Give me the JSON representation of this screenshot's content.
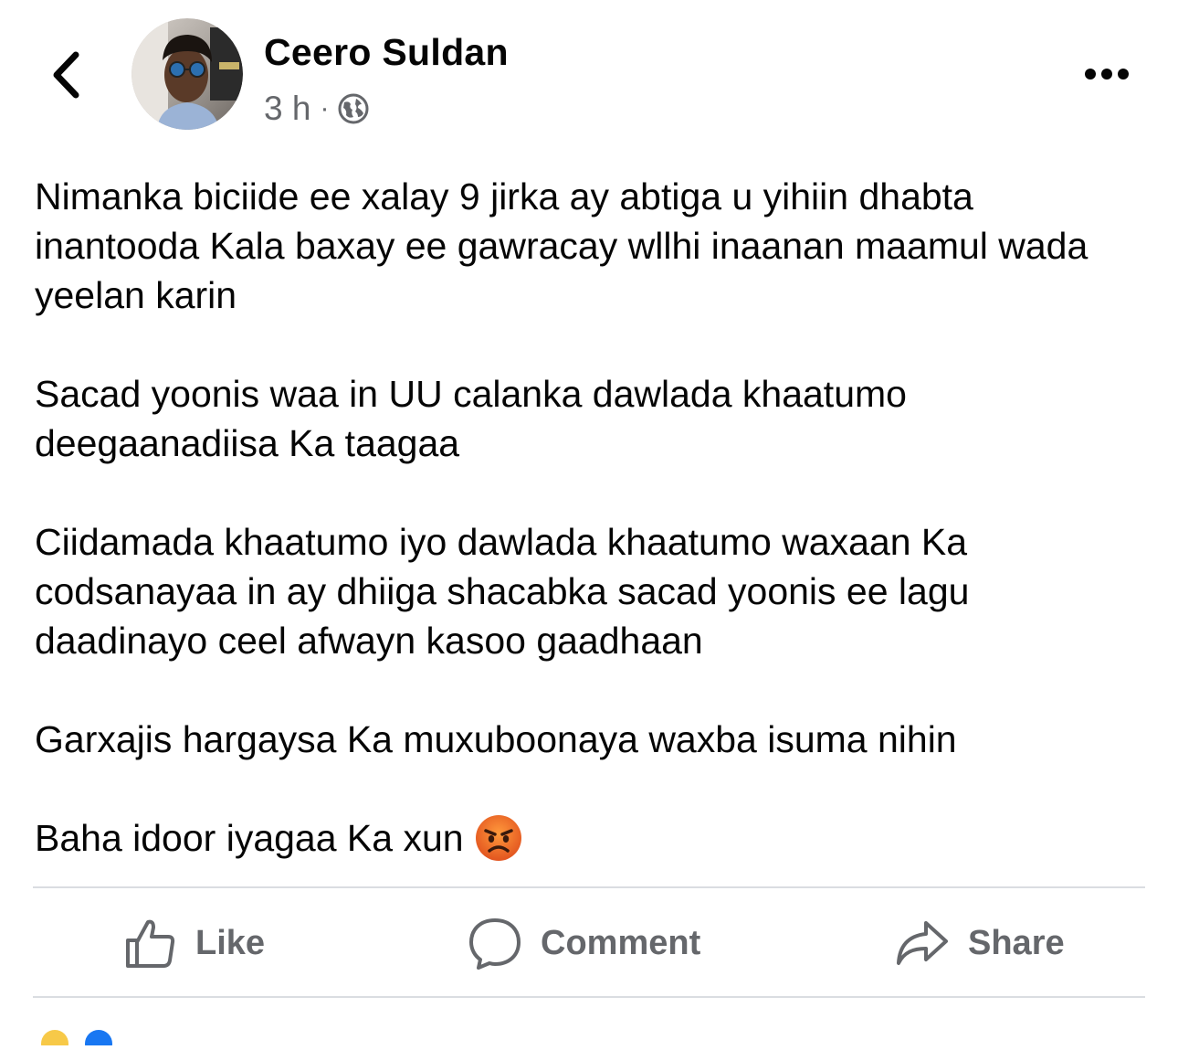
{
  "post": {
    "author": "Ceero Suldan",
    "time": "3 h",
    "separator": "·",
    "privacy_icon": "globe-icon",
    "paragraphs": [
      "Nimanka biciide ee xalay 9 jirka ay abtiga u yihiin dhabta inantooda Kala baxay ee gawracay wllhi inaanan maamul wada yeelan karin",
      "Sacad yoonis waa in UU calanka dawlada khaatumo deegaanadiisa Ka taagaa",
      "Ciidamada khaatumo iyo dawlada khaatumo waxaan Ka codsanayaa in ay dhiiga shacabka sacad yoonis ee lagu daadinayo ceel afwayn kasoo gaadhaan",
      "Garxajis hargaysa Ka muxuboonaya waxba isuma nihin",
      "Baha idoor iyagaa Ka xun"
    ],
    "final_emoji": "angry-face-emoji"
  },
  "actions": {
    "like_label": "Like",
    "comment_label": "Comment",
    "share_label": "Share"
  },
  "colors": {
    "text_primary": "#050505",
    "text_secondary": "#65676b",
    "divider": "#dadde1"
  }
}
